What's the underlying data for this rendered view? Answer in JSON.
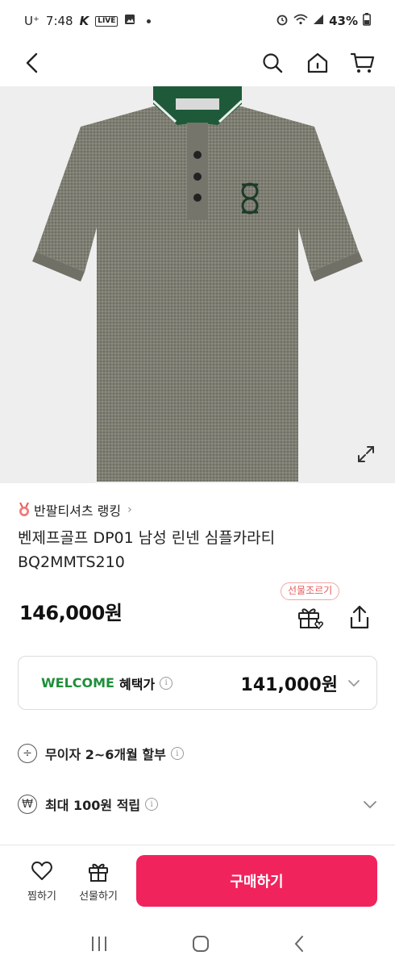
{
  "status_bar": {
    "carrier": "U⁺",
    "time": "7:48",
    "live_badge": "LIVE",
    "battery": "43%"
  },
  "icons": {
    "back": "chevron-left-icon",
    "search": "search-icon",
    "home": "home-icon",
    "cart": "cart-icon",
    "expand": "expand-icon",
    "gift": "gift-icon",
    "share": "share-icon",
    "wish": "heart-icon"
  },
  "product": {
    "ranking": "반팔티셔츠 랭킹",
    "name_line1": "벤제프골프 DP01 남성 린넨 심플카라티",
    "name_line2": "BQ2MMTS210",
    "price": "146,000원",
    "gift_tag": "선물조르기"
  },
  "welcome": {
    "label": "WELCOME",
    "sub": "혜택가",
    "price": "141,000원"
  },
  "benefits": [
    {
      "icon": "÷",
      "label": "무이자 2~6개월 할부"
    },
    {
      "icon": "₩",
      "label": "최대 100원 적립"
    }
  ],
  "bottom_bar": {
    "wish_label": "찜하기",
    "gift_label": "선물하기",
    "buy_label": "구매하기"
  },
  "colors": {
    "accent": "#f0235d",
    "welcome_green": "#1f8f3a",
    "shirt": "#7b7b70",
    "collar": "#1e5a3a"
  }
}
